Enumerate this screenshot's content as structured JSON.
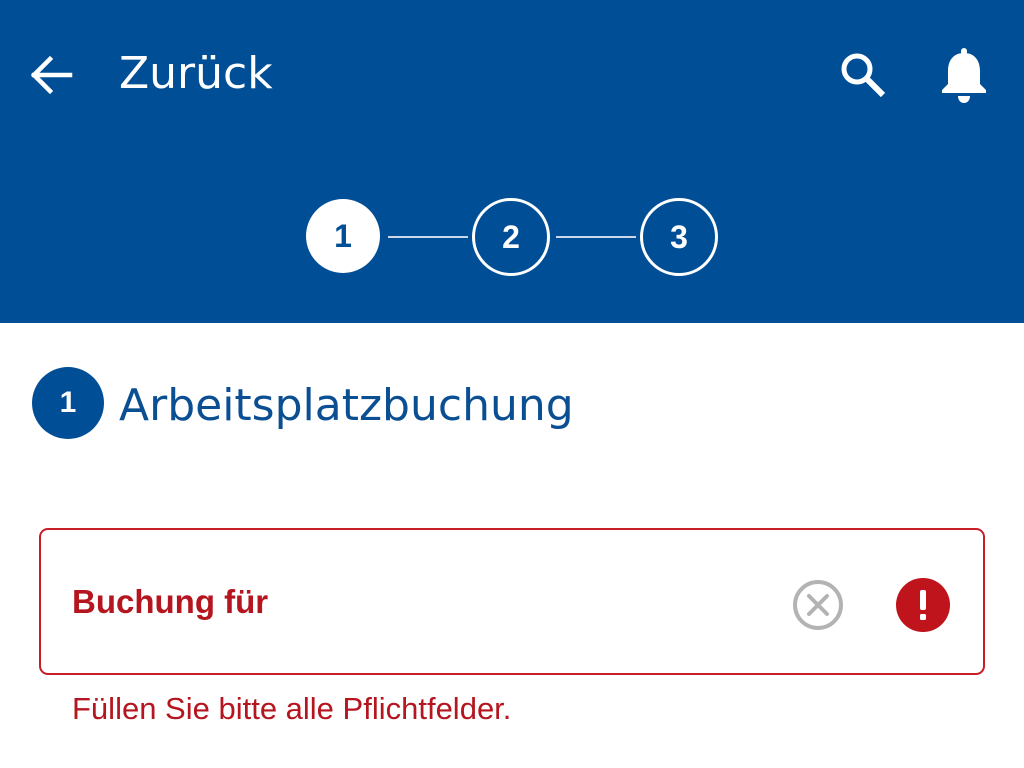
{
  "header": {
    "back_label": "Zurück",
    "icons": {
      "back": "arrow-left-icon",
      "search": "search-icon",
      "notifications": "bell-icon"
    }
  },
  "stepper": {
    "current_step": 1,
    "steps": [
      {
        "label": "1"
      },
      {
        "label": "2"
      },
      {
        "label": "3"
      }
    ]
  },
  "section": {
    "number": "1",
    "title": "Arbeitsplatzbuchung"
  },
  "field": {
    "label": "Buchung für",
    "value": "",
    "state": "error",
    "icons": {
      "clear": "clear-circle-icon",
      "error": "error-exclamation-icon"
    }
  },
  "validation": {
    "message": "Füllen Sie bitte alle Pflichtfelder."
  },
  "colors": {
    "primary": "#004e95",
    "error": "#c0141c",
    "error_text": "#b4151f",
    "background": "#ffffff",
    "muted_icon": "#b3b3b3"
  }
}
